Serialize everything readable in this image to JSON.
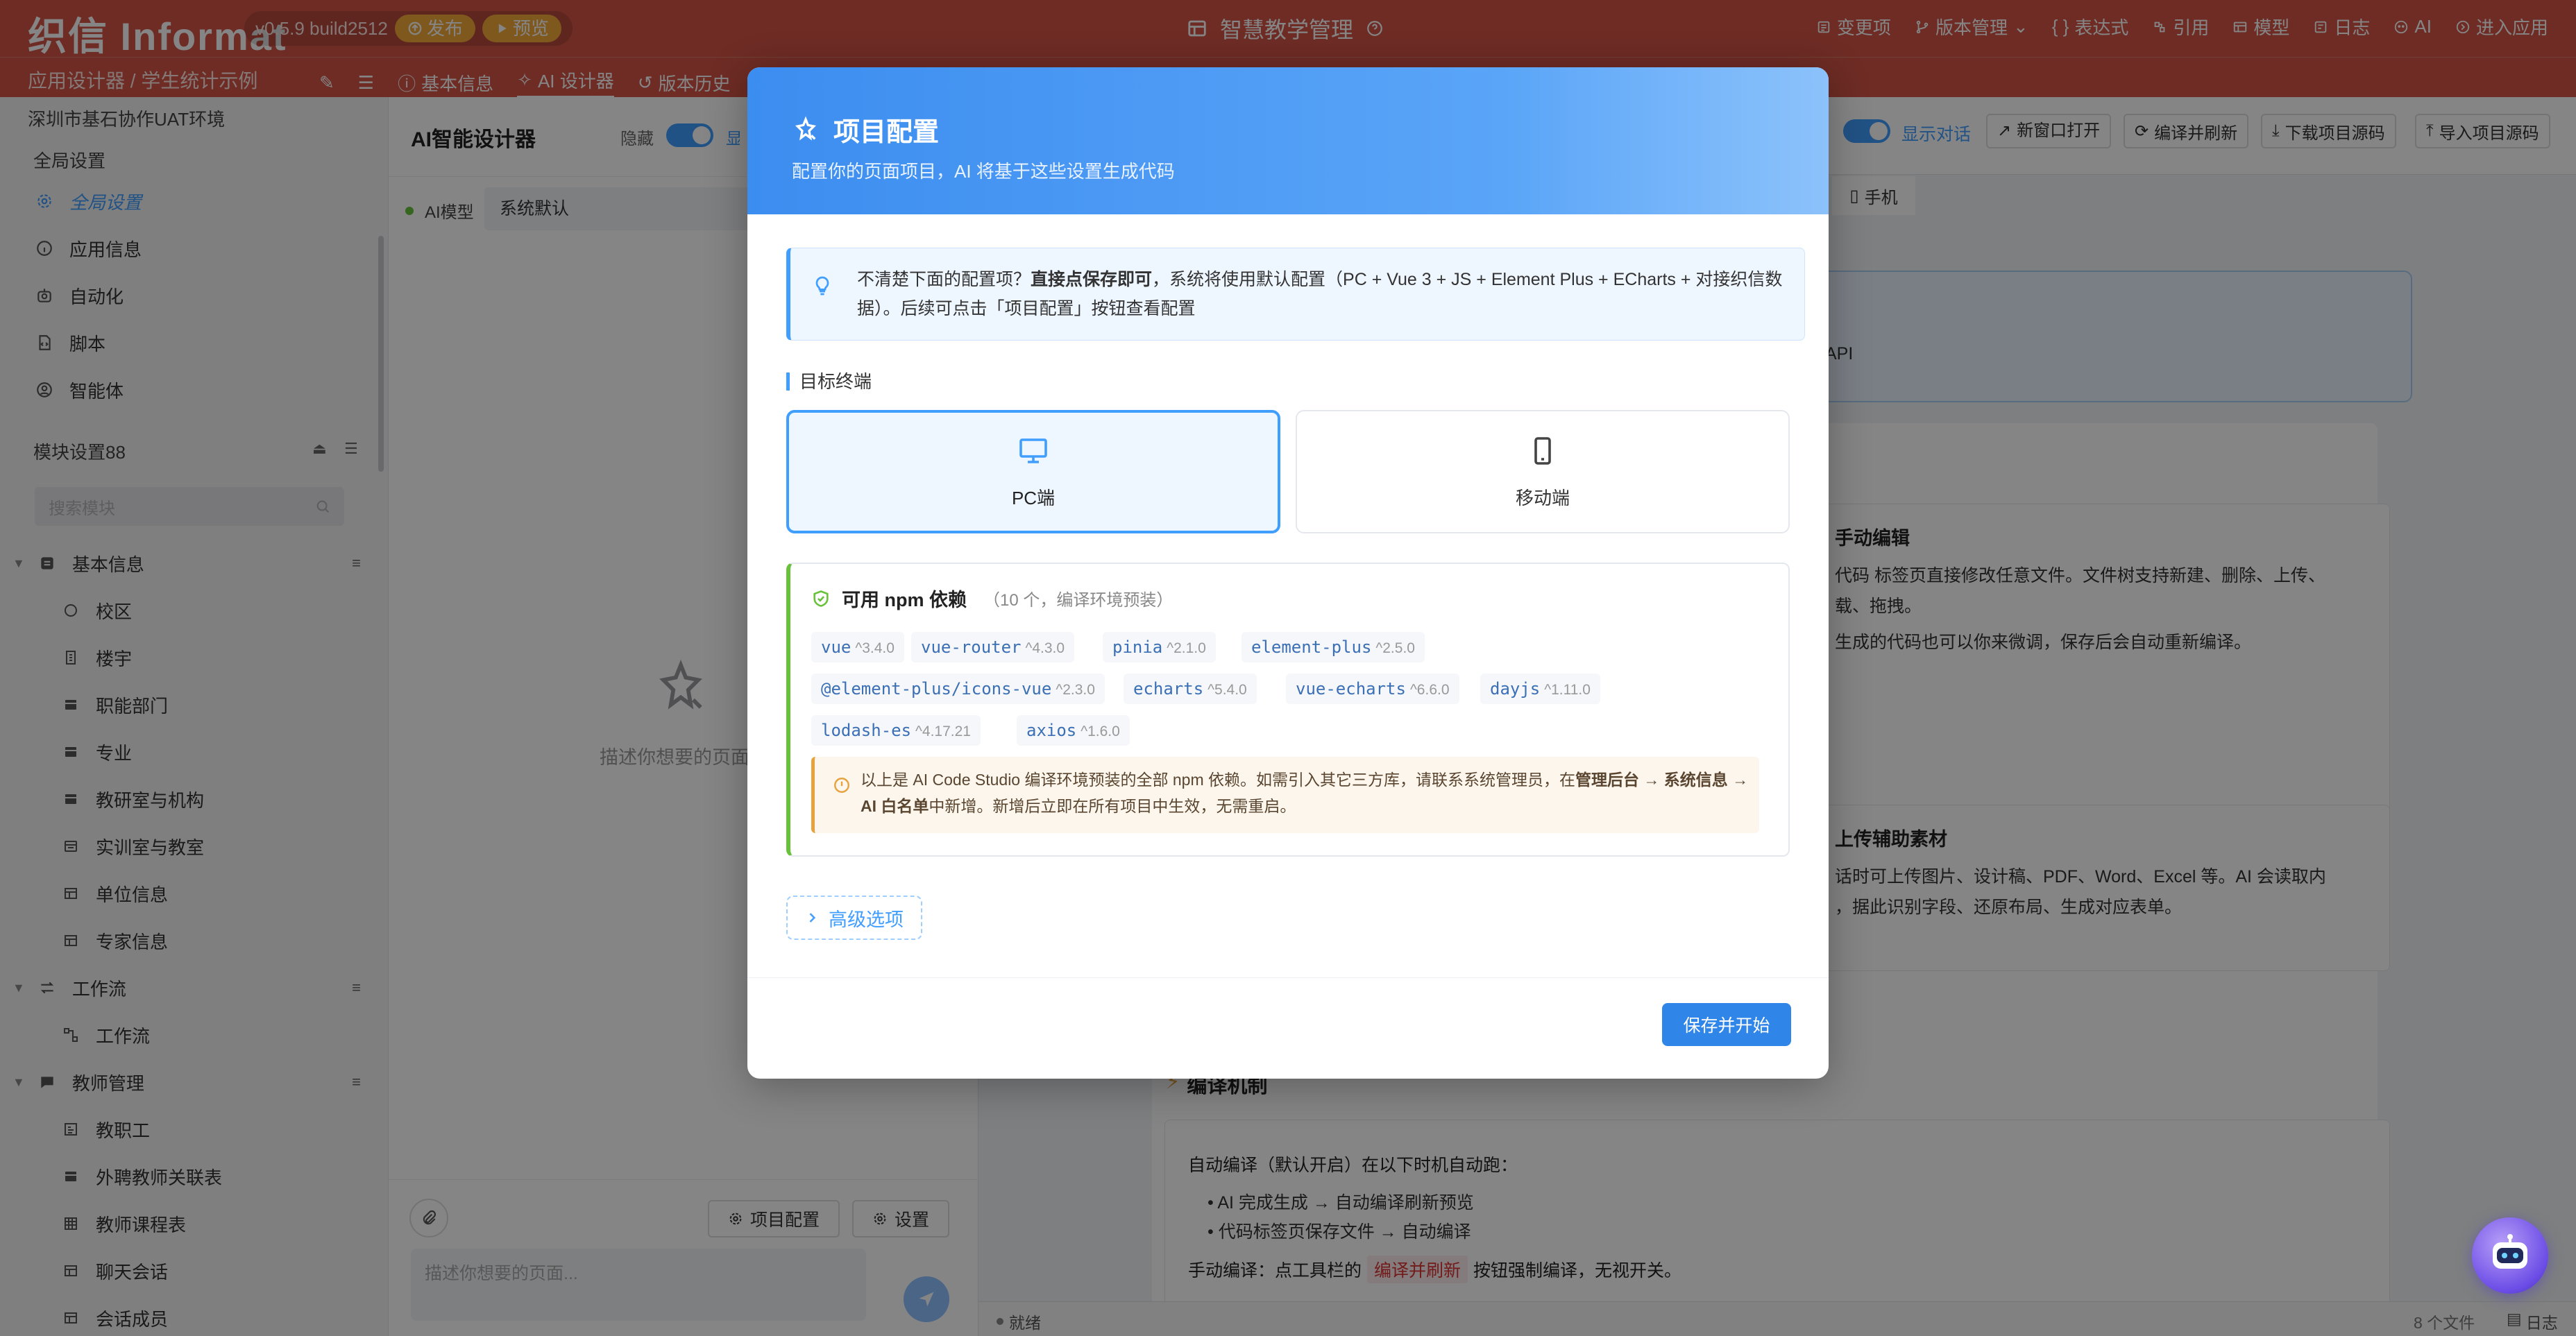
{
  "app": {
    "logo": "织信 Informat",
    "version": "v0.5.9 build2512",
    "publish_label": "发布",
    "preview_label": "预览",
    "title": "智慧教学管理"
  },
  "top_menu": [
    "变更项",
    "版本管理",
    "表达式",
    "引用",
    "模型",
    "日志",
    "AI",
    "进入应用"
  ],
  "breadcrumb": "应用设计器 / 学生统计示例",
  "tabs": [
    "基本信息",
    "AI 设计器",
    "版本历史"
  ],
  "sidebar": {
    "env": "深圳市基石协作UAT环境",
    "global_header": "全局设置",
    "global_items": [
      "全局设置",
      "应用信息",
      "自动化",
      "脚本",
      "智能体"
    ],
    "module_header": "模块设置88",
    "search_placeholder": "搜索模块",
    "groups": [
      {
        "label": "基本信息",
        "items": [
          "校区",
          "楼宇",
          "职能部门",
          "专业",
          "教研室与机构",
          "实训室与教室",
          "单位信息",
          "专家信息"
        ]
      },
      {
        "label": "工作流",
        "items": [
          "工作流"
        ]
      },
      {
        "label": "教师管理",
        "items": [
          "教职工",
          "外聘教师关联表",
          "教师课程表",
          "聊天会话",
          "会话成员"
        ]
      }
    ]
  },
  "designer": {
    "title": "AI智能设计器",
    "hide_label": "隐藏",
    "show_label": "显示对话",
    "model_label": "AI模型",
    "model_value": "系统默认",
    "empty_hint": "描述你想要的页面",
    "project_config_btn": "项目配置",
    "settings_btn": "设置",
    "input_placeholder": "描述你想要的页面..."
  },
  "right": {
    "show_dialog": "显示对话",
    "toolbar": [
      "新窗口打开",
      "编译并刷新",
      "下载项目源码",
      "导入项目源码"
    ],
    "device_mobile": "手机",
    "api_fragment": "API",
    "manual_edit_title": "手动编辑",
    "manual_edit_line1": "代码 标签页直接修改任意文件。文件树支持新建、删除、上传、",
    "manual_edit_line2": "载、拖拽。",
    "manual_edit_line3": "生成的代码也可以你来微调，保存后会自动重新编译。",
    "upload_title": "上传辅助素材",
    "upload_line1": "话时可上传图片、设计稿、PDF、Word、Excel 等。AI 会读取内",
    "upload_line2": "，据此识别字段、还原布局、生成对应表单。",
    "compile_title": "编译机制",
    "auto_compile": "自动编译（默认开启）在以下时机自动跑：",
    "bullets": [
      "AI 完成生成 → 自动编译刷新预览",
      "代码标签页保存文件 → 自动编译"
    ],
    "manual_compile_prefix": "手动编译：点工具栏的",
    "manual_compile_tag": "编译并刷新",
    "manual_compile_suffix": "按钮强制编译，无视开关。",
    "status_ready": "就绪",
    "file_count": "8 个文件",
    "log_label": "日志"
  },
  "modal": {
    "title": "项目配置",
    "subtitle": "配置你的页面项目，AI 将基于这些设置生成代码",
    "info_prefix": "不清楚下面的配置项？",
    "info_bold": "直接点保存即可",
    "info_rest": "，系统将使用默认配置（PC + Vue 3 + JS + Element Plus + ECharts + 对接织信数据）。后续可点击「项目配置」按钮查看配置",
    "target_label": "目标终端",
    "option_pc": "PC端",
    "option_mobile": "移动端",
    "npm_title": "可用 npm 依赖",
    "npm_count": "（10 个，编译环境预装）",
    "packages": [
      {
        "name": "vue",
        "version": "^3.4.0"
      },
      {
        "name": "vue-router",
        "version": "^4.3.0"
      },
      {
        "name": "pinia",
        "version": "^2.1.0"
      },
      {
        "name": "element-plus",
        "version": "^2.5.0"
      },
      {
        "name": "@element-plus/icons-vue",
        "version": "^2.3.0"
      },
      {
        "name": "echarts",
        "version": "^5.4.0"
      },
      {
        "name": "vue-echarts",
        "version": "^6.6.0"
      },
      {
        "name": "dayjs",
        "version": "^1.11.0"
      },
      {
        "name": "lodash-es",
        "version": "^4.17.21"
      },
      {
        "name": "axios",
        "version": "^1.6.0"
      }
    ],
    "warn_text_1": "以上是 AI Code Studio 编译环境预装的全部 npm 依赖。如需引入其它三方库，请联系系统管理员，在",
    "warn_bold_1": "管理后台 → 系统信息",
    "warn_bold_2": "→ AI 白名单",
    "warn_text_2": "中新增。新增后立即在所有项目中生效，无需重启。",
    "advanced_label": "高级选项",
    "save_button": "保存并开始"
  },
  "colors": {
    "brand_red": "#d35547",
    "primary_blue": "#409eff",
    "success_green": "#67c23a",
    "warning_orange": "#e6a23c"
  }
}
